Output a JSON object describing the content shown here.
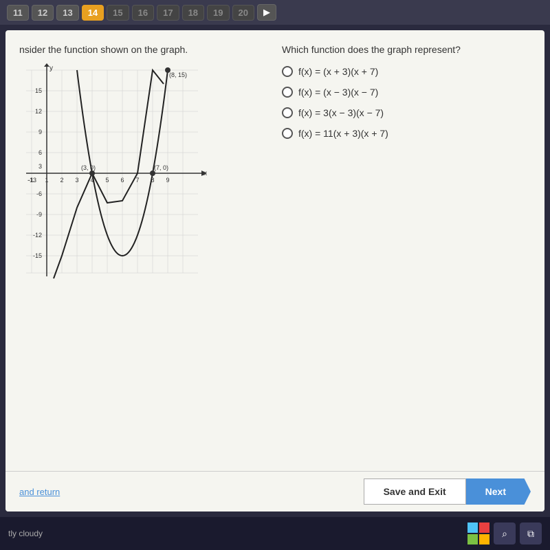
{
  "nav": {
    "numbers": [
      11,
      12,
      13,
      14,
      15,
      16,
      17,
      18,
      19,
      20
    ],
    "active": 14,
    "arrow_label": "▶"
  },
  "question": {
    "left_text": "nsider the function shown on the graph.",
    "right_text": "Which function does the graph represent?",
    "graph": {
      "points": [
        {
          "label": "(8, 15)",
          "x": 8,
          "y": 15
        },
        {
          "label": "(3, 0)",
          "x": 3,
          "y": 0
        },
        {
          "label": "(7, 0)",
          "x": 7,
          "y": 0
        }
      ],
      "x_axis_label": "x",
      "y_axis_label": "y"
    },
    "choices": [
      {
        "id": "a",
        "text": "f(x) = (x + 3)(x + 7)"
      },
      {
        "id": "b",
        "text": "f(x) = (x − 3)(x − 7)"
      },
      {
        "id": "c",
        "text": "f(x) = 3(x − 3)(x − 7)"
      },
      {
        "id": "d",
        "text": "f(x) = 11(x + 3)(x + 7)"
      }
    ]
  },
  "bottom": {
    "skip_label": "and return",
    "save_exit_label": "Save and Exit",
    "next_label": "Next"
  },
  "taskbar": {
    "weather": "tly cloudy"
  }
}
